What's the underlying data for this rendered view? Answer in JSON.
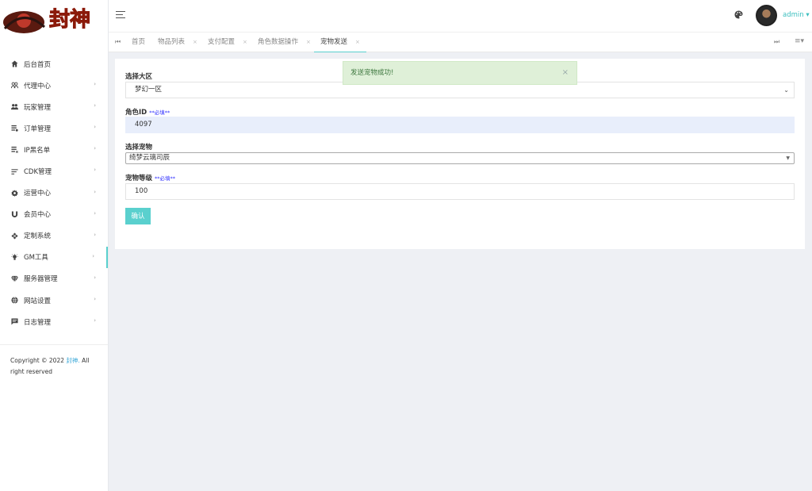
{
  "header": {
    "user_name": "admin ▾"
  },
  "sidebar": {
    "logo_text": "封神",
    "items": [
      {
        "label": "后台首页",
        "icon": "home-icon",
        "arrow": false
      },
      {
        "label": "代理中心",
        "icon": "agents-icon",
        "arrow": true
      },
      {
        "label": "玩家管理",
        "icon": "players-icon",
        "arrow": true
      },
      {
        "label": "订单管理",
        "icon": "orders-icon",
        "arrow": true
      },
      {
        "label": "IP黑名单",
        "icon": "blacklist-icon",
        "arrow": true
      },
      {
        "label": "CDK管理",
        "icon": "cdk-icon",
        "arrow": true
      },
      {
        "label": "运营中心",
        "icon": "gear-icon",
        "arrow": true
      },
      {
        "label": "会员中心",
        "icon": "magnet-icon",
        "arrow": true
      },
      {
        "label": "定制系统",
        "icon": "custom-icon",
        "arrow": true
      },
      {
        "label": "GM工具",
        "icon": "bulb-icon",
        "arrow": true,
        "active": true
      },
      {
        "label": "服务器管理",
        "icon": "diamond-icon",
        "arrow": true
      },
      {
        "label": "网站设置",
        "icon": "globe-icon",
        "arrow": true
      },
      {
        "label": "日志管理",
        "icon": "comment-icon",
        "arrow": true
      }
    ],
    "arrow_glyph": "›",
    "copyright_prefix": "Copyright © 2022 ",
    "copyright_brand": "封神.",
    "copyright_suffix": " All right reserved"
  },
  "tabs": [
    {
      "label": "首页",
      "closable": false
    },
    {
      "label": "物品列表",
      "closable": true
    },
    {
      "label": "支付配置",
      "closable": true
    },
    {
      "label": "角色数据操作",
      "closable": true
    },
    {
      "label": "宠物发送",
      "closable": true,
      "active": true
    }
  ],
  "tab_close_glyph": "×",
  "form": {
    "zone_label": "选择大区",
    "zone_value": "梦幻一区",
    "role_label": "角色ID",
    "role_required": "**必填**",
    "role_value": "4097",
    "pet_label": "选择宠物",
    "pet_value": "绮梦云璃司辰",
    "level_label": "宠物等级",
    "level_required": "**必填**",
    "level_value": "100",
    "submit_label": "确认"
  },
  "toast": {
    "message": "发送宠物成功!",
    "close": "×"
  },
  "colors": {
    "accent": "#5ad0ce",
    "admin": "#3bbfbf",
    "toast_bg": "#dff0d8",
    "toast_text": "#3c763d"
  }
}
